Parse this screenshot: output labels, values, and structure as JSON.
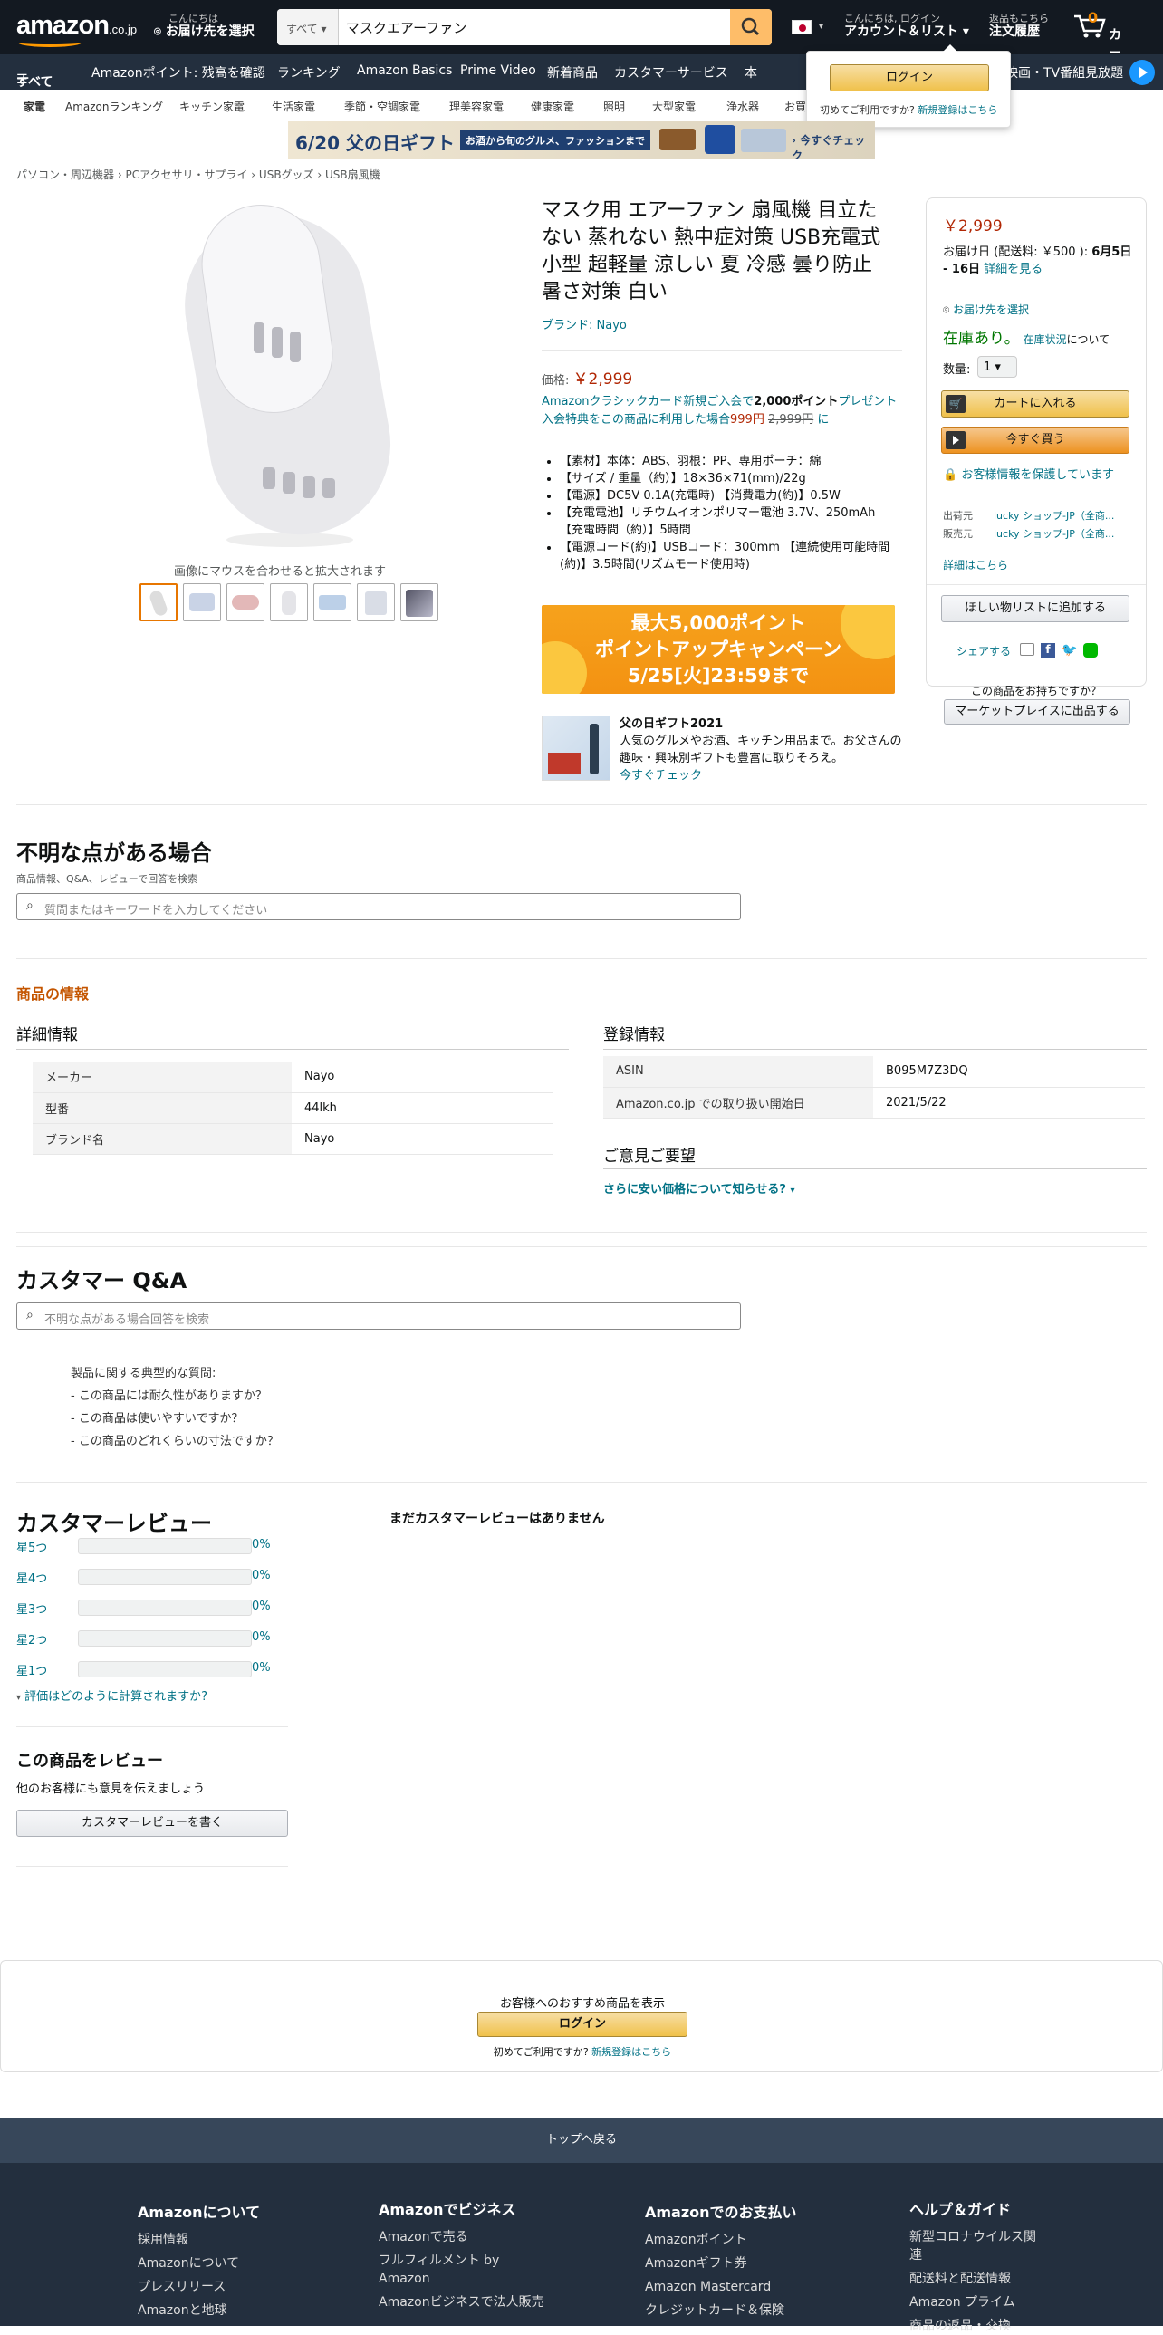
{
  "header": {
    "logo": "amazon",
    "logo_suffix": ".co.jp",
    "deliver_line1": "こんにちは",
    "deliver_line2": "お届け先を選択",
    "search_category": "すべて",
    "search_value": "マスクエアーファン",
    "account_line1": "こんにちは, ログイン",
    "account_line2": "アカウント＆リスト",
    "orders_line1": "返品もこちら",
    "orders_line2": "注文履歴",
    "cart_count": "0",
    "cart_label": "カート"
  },
  "nav": {
    "all": "すべて",
    "items": [
      "Amazonポイント: 残高を確認",
      "ランキング",
      "Amazon Basics",
      "Prime Video",
      "新着商品",
      "カスタマーサービス",
      "本"
    ],
    "right": "映画・TV番組見放題"
  },
  "subnav": {
    "items": [
      "家電",
      "Amazonランキング",
      "キッチン家電",
      "生活家電",
      "季節・空調家電",
      "理美容家電",
      "健康家電",
      "照明",
      "大型家電",
      "浄水器",
      "お買"
    ]
  },
  "signin_popup": {
    "button": "ログイン",
    "new_text": "初めてご利用ですか?",
    "new_link": "新規登録はこちら"
  },
  "banner": {
    "date": "6/20",
    "title": "父の日ギフト",
    "sub": "お酒から旬のグルメ、ファッションまで",
    "cta": "今すぐチェック"
  },
  "breadcrumb": [
    "パソコン・周辺機器",
    "PCアクセサリ・サプライ",
    "USBグッズ",
    "USB扇風機"
  ],
  "gallery": {
    "hint": "画像にマウスを合わせると拡大されます",
    "thumb_count": 7
  },
  "product": {
    "title": "マスク用 エアーファン 扇風機 目立たない 蒸れない 熱中症対策 USB充電式 小型 超軽量 涼しい 夏 冷感 曇り防止 暑さ対策 白い",
    "brand": "ブランド: Nayo",
    "price_label": "価格:",
    "price": "￥2,999",
    "promo_line1": "Amazonクラシックカード新規ご入会で",
    "promo_points": "2,000ポイント",
    "promo_line1_end": "プレゼント",
    "promo_line2": "入会特典をこの商品に利用した場合",
    "promo_new_price": "999円",
    "promo_old_price": "2,999円",
    "promo_line2_end": "に",
    "bullets": [
      "【素材】本体：ABS、羽根：PP、専用ポーチ：綿",
      "【サイズ / 重量（約）】18×36×71(mm)/22g",
      "【電源】DC5V 0.1A(充電時) 【消費電力(約)】0.5W",
      "【充電電池】リチウムイオンポリマー電池 3.7V、250mAh 【充電時間（約）】5時間",
      "【電源コード(約)】USBコード：300mm 【連続使用可能時間(約)】3.5時間(リズムモード使用時)"
    ]
  },
  "campaign": {
    "line1": "最大5,000ポイント",
    "line2": "ポイントアップキャンペーン",
    "line3": "5/25[火]23:59まで"
  },
  "gift": {
    "title": "父の日ギフト2021",
    "desc": "人気のグルメやお酒、キッチン用品まで。お父さんの趣味・興味別ギフトも豊富に取りそろえ。",
    "link": "今すぐチェック"
  },
  "buybox": {
    "price": "￥2,999",
    "delivery_text": "お届け日 (配送料: ￥500 ):",
    "delivery_date": "6月5日 - 16日",
    "delivery_link": "詳細を見る",
    "address_link": "お届け先を選択",
    "stock": "在庫あり。",
    "stock_link": "在庫状況",
    "stock_suffix": "について",
    "qty_label": "数量:",
    "qty_value": "1",
    "add_to_cart": "カートに入れる",
    "buy_now": "今すぐ買う",
    "secure": "お客様情報を保護しています",
    "ship_from_label": "出荷元",
    "ship_from": "lucky ショップ-JP（全商...",
    "seller_label": "販売元",
    "seller": "lucky ショップ-JP（全商...",
    "details_link": "詳細はこちら",
    "wishlist": "ほしい物リストに追加する",
    "share": "シェアする",
    "have_one": "この商品をお持ちですか？",
    "sell": "マーケットプレイスに出品する"
  },
  "questions": {
    "title": "不明な点がある場合",
    "sub": "商品情報、Q&A、レビューで回答を検索",
    "placeholder": "質問またはキーワードを入力してください"
  },
  "info": {
    "title": "商品の情報",
    "details_title": "詳細情報",
    "details": [
      {
        "k": "メーカー",
        "v": "Nayo"
      },
      {
        "k": "型番",
        "v": "44lkh"
      },
      {
        "k": "ブランド名",
        "v": "Nayo"
      }
    ],
    "reg_title": "登録情報",
    "reg": [
      {
        "k": "ASIN",
        "v": "B095M7Z3DQ"
      },
      {
        "k": "Amazon.co.jp での取り扱い開始日",
        "v": "2021/5/22"
      }
    ],
    "feedback_title": "ご意見ご要望",
    "feedback_link": "さらに安い価格について知らせる?"
  },
  "qa": {
    "title": "カスタマー Q&A",
    "placeholder": "不明な点がある場合回答を検索",
    "typical": "製品に関する典型的な質問:",
    "items": [
      "この商品には耐久性がありますか？",
      "この商品は使いやすいですか？",
      "この商品のどれくらいの寸法ですか？"
    ]
  },
  "reviews": {
    "title": "カスタマーレビュー",
    "none": "まだカスタマーレビューはありません",
    "stars": [
      {
        "label": "星5つ",
        "pct": "0%"
      },
      {
        "label": "星4つ",
        "pct": "0%"
      },
      {
        "label": "星3つ",
        "pct": "0%"
      },
      {
        "label": "星2つ",
        "pct": "0%"
      },
      {
        "label": "星1つ",
        "pct": "0%"
      }
    ],
    "how_link": "評価はどのように計算されますか?",
    "write_title": "この商品をレビュー",
    "write_sub": "他のお客様にも意見を伝えましょう",
    "write_button": "カスタマーレビューを書く"
  },
  "recommend": {
    "text": "お客様へのおすすめ商品を表示",
    "button": "ログイン",
    "new_text": "初めてご利用ですか?",
    "new_link": "新規登録はこちら"
  },
  "footer": {
    "back_to_top": "トップへ戻る",
    "cols": [
      {
        "title": "Amazonについて",
        "items": [
          "採用情報",
          "Amazonについて",
          "プレスリリース",
          "Amazonと地球"
        ]
      },
      {
        "title": "Amazonでビジネス",
        "items": [
          "Amazonで売る",
          "フルフィルメント by Amazon",
          "Amazonビジネスで法人販売"
        ]
      },
      {
        "title": "Amazonでのお支払い",
        "items": [
          "Amazonポイント",
          "Amazonギフト券",
          "Amazon Mastercard",
          "クレジットカード＆保険"
        ]
      },
      {
        "title": "ヘルプ＆ガイド",
        "items": [
          "新型コロナウイルス関連",
          "配送料と配送情報",
          "Amazon プライム",
          "商品の返品・交換"
        ]
      }
    ]
  },
  "colors": {
    "header": "#131921",
    "nav": "#232f3e",
    "accent": "#ff9900",
    "price": "#b12704",
    "link": "#007185",
    "footer": "#232f3e",
    "backtop": "#37475a"
  }
}
